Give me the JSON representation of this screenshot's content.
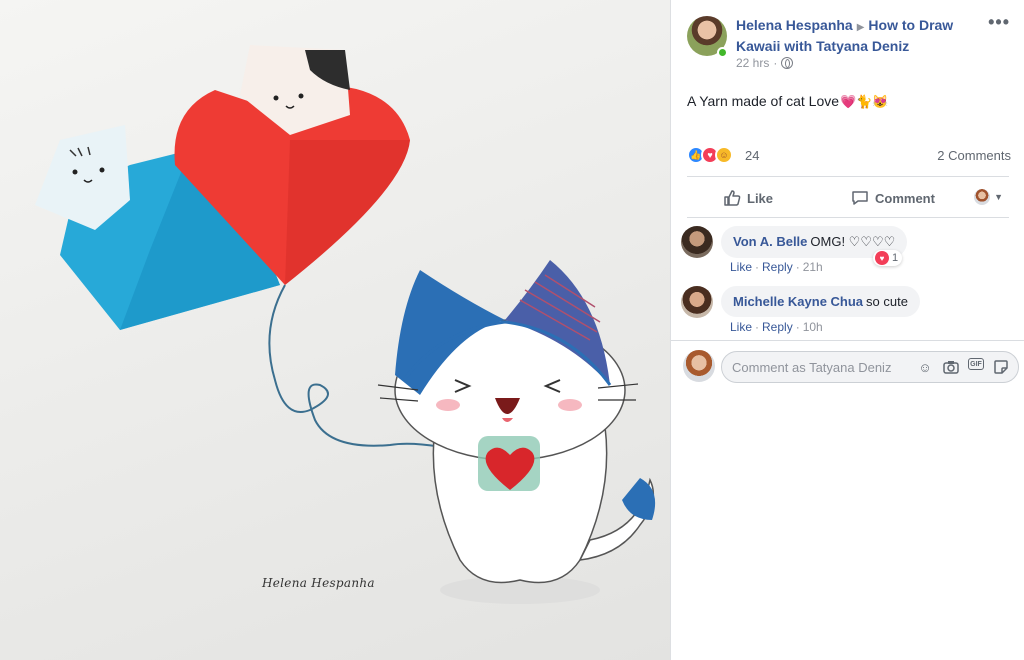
{
  "post": {
    "author": "Helena Hespanha",
    "group": "How to Draw Kawaii with Tatyana Deniz",
    "time": "22 hrs",
    "caption": "A Yarn made of cat Love",
    "caption_emoji": "💗🐈😻",
    "more_label": "•••"
  },
  "photo": {
    "signature": "Helena Hespanha"
  },
  "reactions": {
    "count": "24",
    "comments_label": "2 Comments",
    "icons": [
      "like-icon",
      "love-icon",
      "care-icon"
    ]
  },
  "actions": {
    "like_label": "Like",
    "comment_label": "Comment"
  },
  "comments": [
    {
      "author": "Von A. Belle",
      "text": "OMG! ♡♡♡♡",
      "like_label": "Like",
      "reply_label": "Reply",
      "time": "21h",
      "reaction_count": "1"
    },
    {
      "author": "Michelle Kayne Chua",
      "text": "so cute",
      "like_label": "Like",
      "reply_label": "Reply",
      "time": "10h"
    }
  ],
  "composer": {
    "placeholder": "Comment as Tatyana Deniz",
    "icons": [
      "emoji-icon",
      "camera-icon",
      "gif-icon",
      "sticker-icon"
    ]
  },
  "colors": {
    "link": "#385898",
    "meta": "#90949c",
    "like_blue": "#2d88ff",
    "love_red": "#f33e58"
  }
}
